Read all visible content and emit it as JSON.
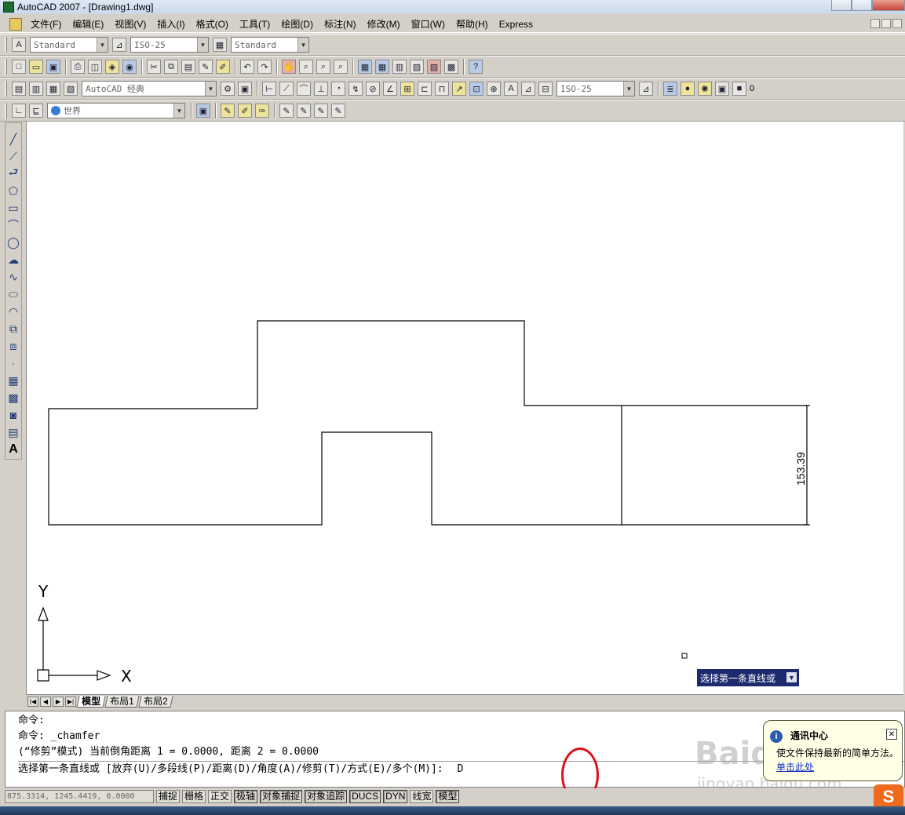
{
  "window": {
    "title": "AutoCAD 2007 - [Drawing1.dwg]"
  },
  "menu": {
    "items": [
      "文件(F)",
      "编辑(E)",
      "视图(V)",
      "插入(I)",
      "格式(O)",
      "工具(T)",
      "绘图(D)",
      "标注(N)",
      "修改(M)",
      "窗口(W)",
      "帮助(H)",
      "Express"
    ]
  },
  "toolbars": {
    "text_style": "Standard",
    "dim_style": "ISO-25",
    "table_style": "Standard",
    "workspace": "AutoCAD 经典",
    "dim_style2": "ISO-25",
    "ucs": "世界",
    "layer": "0"
  },
  "drawing": {
    "dimension_text": "153.39",
    "ucs_y_label": "Y",
    "ucs_x_label": "X"
  },
  "dynamic_tooltip": {
    "text": "选择第一条直线或"
  },
  "layout_tabs": [
    "模型",
    "布局1",
    "布局2"
  ],
  "command_line": {
    "lines": [
      "命令:",
      "命令: _chamfer",
      "(“修剪”模式) 当前倒角距离 1 = 0.0000, 距离 2 = 0.0000"
    ],
    "prompt": "选择第一条直线或 [放弃(U)/多段线(P)/距离(D)/角度(A)/修剪(T)/方式(E)/多个(M)]:",
    "input": "D"
  },
  "notification": {
    "title": "通讯中心",
    "body": "使文件保持最新的简单方法。",
    "link": "单击此处"
  },
  "watermark": {
    "line1": "Baidu",
    "line2": "jingyan.baidu.com"
  },
  "status_bar": {
    "coordinates": "875.3314, 1245.4419, 0.0000",
    "toggles": [
      "捕捉",
      "栅格",
      "正交",
      "极轴",
      "对象捕捉",
      "对象追踪",
      "DUCS",
      "DYN",
      "线宽",
      "模型"
    ]
  },
  "colors": {
    "tooltip_bg": "#1e2a6e",
    "highlight_circle": "#e0101a",
    "canvas_bg": "#ffffff"
  }
}
